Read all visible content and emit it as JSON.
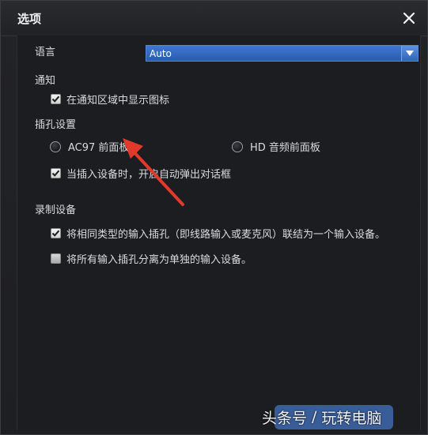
{
  "window": {
    "title": "选项"
  },
  "language": {
    "label": "语言",
    "selected": "Auto"
  },
  "notify": {
    "heading": "通知",
    "show_icon_label": "在通知区域中显示图标",
    "show_icon_checked": true
  },
  "jack": {
    "heading": "插孔设置",
    "ac97_label": "AC97 前面板",
    "hd_label": "HD 音频前面板",
    "popup_label": "当插入设备时，开启自动弹出对话框",
    "popup_checked": true
  },
  "record": {
    "heading": "录制设备",
    "combine_label": "将相同类型的输入插孔（即线路输入或麦克风）联结为一个输入设备。",
    "combine_checked": true,
    "separate_label": "将所有输入插孔分离为单独的输入设备。",
    "separate_checked": false
  },
  "watermark": {
    "source": "头条号",
    "separator": "/",
    "author": "玩转电脑"
  },
  "colors": {
    "accent": "#2f63b8",
    "annotation_arrow": "#e23a2a"
  }
}
